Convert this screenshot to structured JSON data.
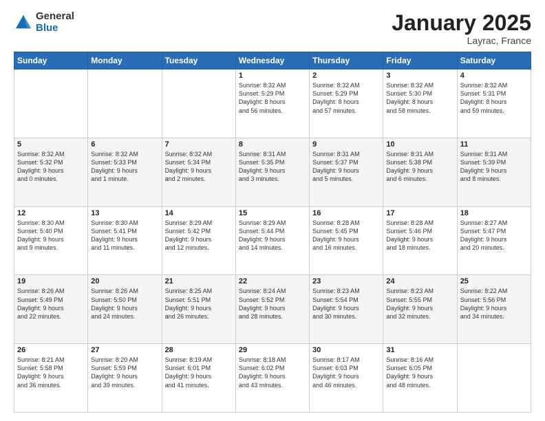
{
  "logo": {
    "general": "General",
    "blue": "Blue"
  },
  "header": {
    "month": "January 2025",
    "location": "Layrac, France"
  },
  "days": [
    "Sunday",
    "Monday",
    "Tuesday",
    "Wednesday",
    "Thursday",
    "Friday",
    "Saturday"
  ],
  "weeks": [
    [
      {
        "day": "",
        "content": ""
      },
      {
        "day": "",
        "content": ""
      },
      {
        "day": "",
        "content": ""
      },
      {
        "day": "1",
        "content": "Sunrise: 8:32 AM\nSunset: 5:29 PM\nDaylight: 8 hours\nand 56 minutes."
      },
      {
        "day": "2",
        "content": "Sunrise: 8:32 AM\nSunset: 5:29 PM\nDaylight: 8 hours\nand 57 minutes."
      },
      {
        "day": "3",
        "content": "Sunrise: 8:32 AM\nSunset: 5:30 PM\nDaylight: 8 hours\nand 58 minutes."
      },
      {
        "day": "4",
        "content": "Sunrise: 8:32 AM\nSunset: 5:31 PM\nDaylight: 8 hours\nand 59 minutes."
      }
    ],
    [
      {
        "day": "5",
        "content": "Sunrise: 8:32 AM\nSunset: 5:32 PM\nDaylight: 9 hours\nand 0 minutes."
      },
      {
        "day": "6",
        "content": "Sunrise: 8:32 AM\nSunset: 5:33 PM\nDaylight: 9 hours\nand 1 minute."
      },
      {
        "day": "7",
        "content": "Sunrise: 8:32 AM\nSunset: 5:34 PM\nDaylight: 9 hours\nand 2 minutes."
      },
      {
        "day": "8",
        "content": "Sunrise: 8:31 AM\nSunset: 5:35 PM\nDaylight: 9 hours\nand 3 minutes."
      },
      {
        "day": "9",
        "content": "Sunrise: 8:31 AM\nSunset: 5:37 PM\nDaylight: 9 hours\nand 5 minutes."
      },
      {
        "day": "10",
        "content": "Sunrise: 8:31 AM\nSunset: 5:38 PM\nDaylight: 9 hours\nand 6 minutes."
      },
      {
        "day": "11",
        "content": "Sunrise: 8:31 AM\nSunset: 5:39 PM\nDaylight: 9 hours\nand 8 minutes."
      }
    ],
    [
      {
        "day": "12",
        "content": "Sunrise: 8:30 AM\nSunset: 5:40 PM\nDaylight: 9 hours\nand 9 minutes."
      },
      {
        "day": "13",
        "content": "Sunrise: 8:30 AM\nSunset: 5:41 PM\nDaylight: 9 hours\nand 11 minutes."
      },
      {
        "day": "14",
        "content": "Sunrise: 8:29 AM\nSunset: 5:42 PM\nDaylight: 9 hours\nand 12 minutes."
      },
      {
        "day": "15",
        "content": "Sunrise: 8:29 AM\nSunset: 5:44 PM\nDaylight: 9 hours\nand 14 minutes."
      },
      {
        "day": "16",
        "content": "Sunrise: 8:28 AM\nSunset: 5:45 PM\nDaylight: 9 hours\nand 16 minutes."
      },
      {
        "day": "17",
        "content": "Sunrise: 8:28 AM\nSunset: 5:46 PM\nDaylight: 9 hours\nand 18 minutes."
      },
      {
        "day": "18",
        "content": "Sunrise: 8:27 AM\nSunset: 5:47 PM\nDaylight: 9 hours\nand 20 minutes."
      }
    ],
    [
      {
        "day": "19",
        "content": "Sunrise: 8:26 AM\nSunset: 5:49 PM\nDaylight: 9 hours\nand 22 minutes."
      },
      {
        "day": "20",
        "content": "Sunrise: 8:26 AM\nSunset: 5:50 PM\nDaylight: 9 hours\nand 24 minutes."
      },
      {
        "day": "21",
        "content": "Sunrise: 8:25 AM\nSunset: 5:51 PM\nDaylight: 9 hours\nand 26 minutes."
      },
      {
        "day": "22",
        "content": "Sunrise: 8:24 AM\nSunset: 5:52 PM\nDaylight: 9 hours\nand 28 minutes."
      },
      {
        "day": "23",
        "content": "Sunrise: 8:23 AM\nSunset: 5:54 PM\nDaylight: 9 hours\nand 30 minutes."
      },
      {
        "day": "24",
        "content": "Sunrise: 8:23 AM\nSunset: 5:55 PM\nDaylight: 9 hours\nand 32 minutes."
      },
      {
        "day": "25",
        "content": "Sunrise: 8:22 AM\nSunset: 5:56 PM\nDaylight: 9 hours\nand 34 minutes."
      }
    ],
    [
      {
        "day": "26",
        "content": "Sunrise: 8:21 AM\nSunset: 5:58 PM\nDaylight: 9 hours\nand 36 minutes."
      },
      {
        "day": "27",
        "content": "Sunrise: 8:20 AM\nSunset: 5:59 PM\nDaylight: 9 hours\nand 39 minutes."
      },
      {
        "day": "28",
        "content": "Sunrise: 8:19 AM\nSunset: 6:01 PM\nDaylight: 9 hours\nand 41 minutes."
      },
      {
        "day": "29",
        "content": "Sunrise: 8:18 AM\nSunset: 6:02 PM\nDaylight: 9 hours\nand 43 minutes."
      },
      {
        "day": "30",
        "content": "Sunrise: 8:17 AM\nSunset: 6:03 PM\nDaylight: 9 hours\nand 46 minutes."
      },
      {
        "day": "31",
        "content": "Sunrise: 8:16 AM\nSunset: 6:05 PM\nDaylight: 9 hours\nand 48 minutes."
      },
      {
        "day": "",
        "content": ""
      }
    ]
  ]
}
